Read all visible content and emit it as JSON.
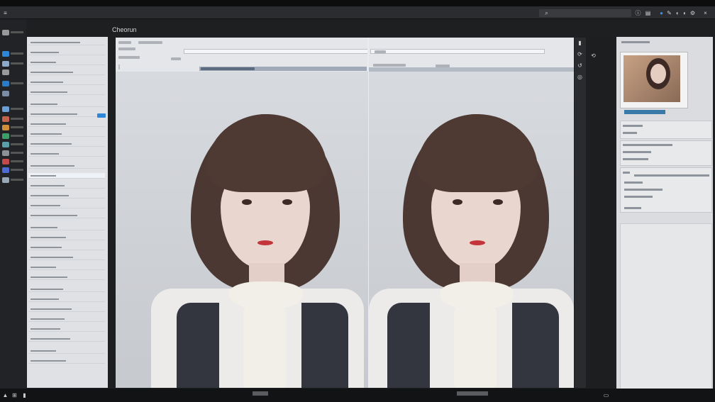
{
  "window": {
    "title": ""
  },
  "toolbar": {
    "path": "",
    "search": "",
    "icons": [
      "circle-icon",
      "brush-icon",
      "ellipse-icon",
      "drop-icon",
      "gear-icon",
      "close-icon"
    ]
  },
  "document": {
    "tab_label": "Cheorun"
  },
  "panes": [
    {
      "name": "original",
      "subject": "portrait"
    },
    {
      "name": "processed",
      "subject": "portrait"
    }
  ],
  "colors": {
    "accent": "#2f86d8",
    "panel": "#dfe1e4",
    "canvas": "#cfd2d8",
    "chrome": "#1e1f21"
  }
}
